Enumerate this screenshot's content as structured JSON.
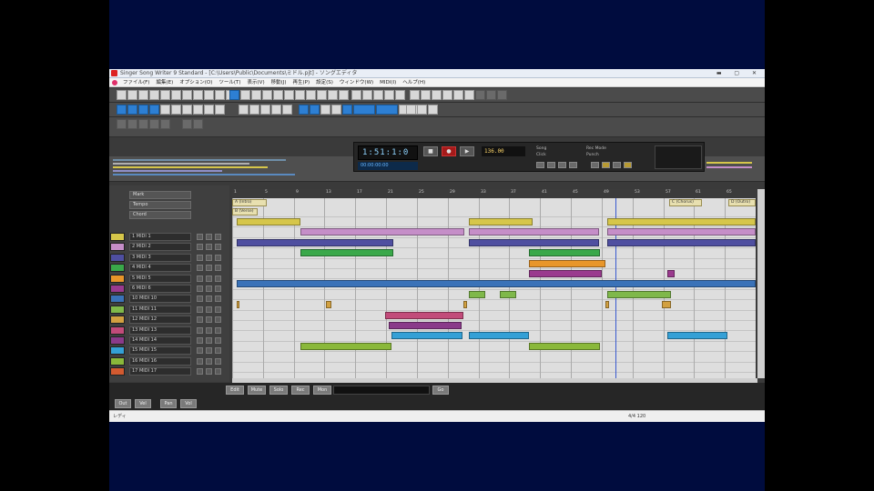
{
  "window": {
    "title": "Singer Song Writer 9 Standard - [C:\\Users\\Public\\Documents\\ミドル.pjt] - ソングエディタ",
    "controls": "▬ ▢ ✕"
  },
  "menubar": {
    "items": [
      "ファイル(F)",
      "編集(E)",
      "オプション(O)",
      "ツール(T)",
      "表示(V)",
      "移動(J)",
      "再生(P)",
      "設定(S)",
      "ウィンドウ(W)",
      "MIDI(I)",
      "ヘルプ(H)"
    ]
  },
  "transport": {
    "time": "1:51:1:0",
    "counter": "00:00:00:00",
    "tempo": "136.00",
    "labels": [
      "Song",
      "Click",
      "Rec Mode",
      "Punch"
    ]
  },
  "tracklist": {
    "headers": [
      "Mark",
      "Tempo",
      "Chord"
    ],
    "tracks": [
      {
        "name": "1 MIDI 1",
        "color": "#d6c64a"
      },
      {
        "name": "2 MIDI 2",
        "color": "#c58ec8"
      },
      {
        "name": "3 MIDI 3",
        "color": "#4f4fa0"
      },
      {
        "name": "4 MIDI 4",
        "color": "#3aa84a"
      },
      {
        "name": "5 MIDI 5",
        "color": "#e8962a"
      },
      {
        "name": "6 MIDI 6",
        "color": "#9a3a8e"
      },
      {
        "name": "10 MIDI 10",
        "color": "#3a72b8"
      },
      {
        "name": "11 MIDI 11",
        "color": "#7fb84a"
      },
      {
        "name": "12 MIDI 12",
        "color": "#d2a040"
      },
      {
        "name": "13 MIDI 13",
        "color": "#c24b7a"
      },
      {
        "name": "14 MIDI 14",
        "color": "#8a3a8a"
      },
      {
        "name": "15 MIDI 15",
        "color": "#34a0d6"
      },
      {
        "name": "16 MIDI 16",
        "color": "#8ab83a"
      },
      {
        "name": "17 MIDI 17",
        "color": "#d25a30"
      }
    ]
  },
  "ruler": {
    "bars": [
      "1",
      "5",
      "9",
      "13",
      "17",
      "21",
      "25",
      "29",
      "33",
      "37",
      "41",
      "45",
      "49",
      "53",
      "57",
      "61",
      "65"
    ]
  },
  "markers": {
    "intro": "A (Intro)",
    "second": "B (Verse)",
    "right1": "C (Chorus)",
    "right2": "D (Outro)"
  },
  "bottombar": {
    "buttons_top": [
      "Edit",
      "Mute",
      "Solo",
      "Rec",
      "Mon"
    ],
    "buttons_bottom": [
      "Out",
      "Vel",
      "Pan",
      "Vol"
    ],
    "go": "Go"
  },
  "status": {
    "left": "レディ",
    "right": "4/4  120"
  }
}
